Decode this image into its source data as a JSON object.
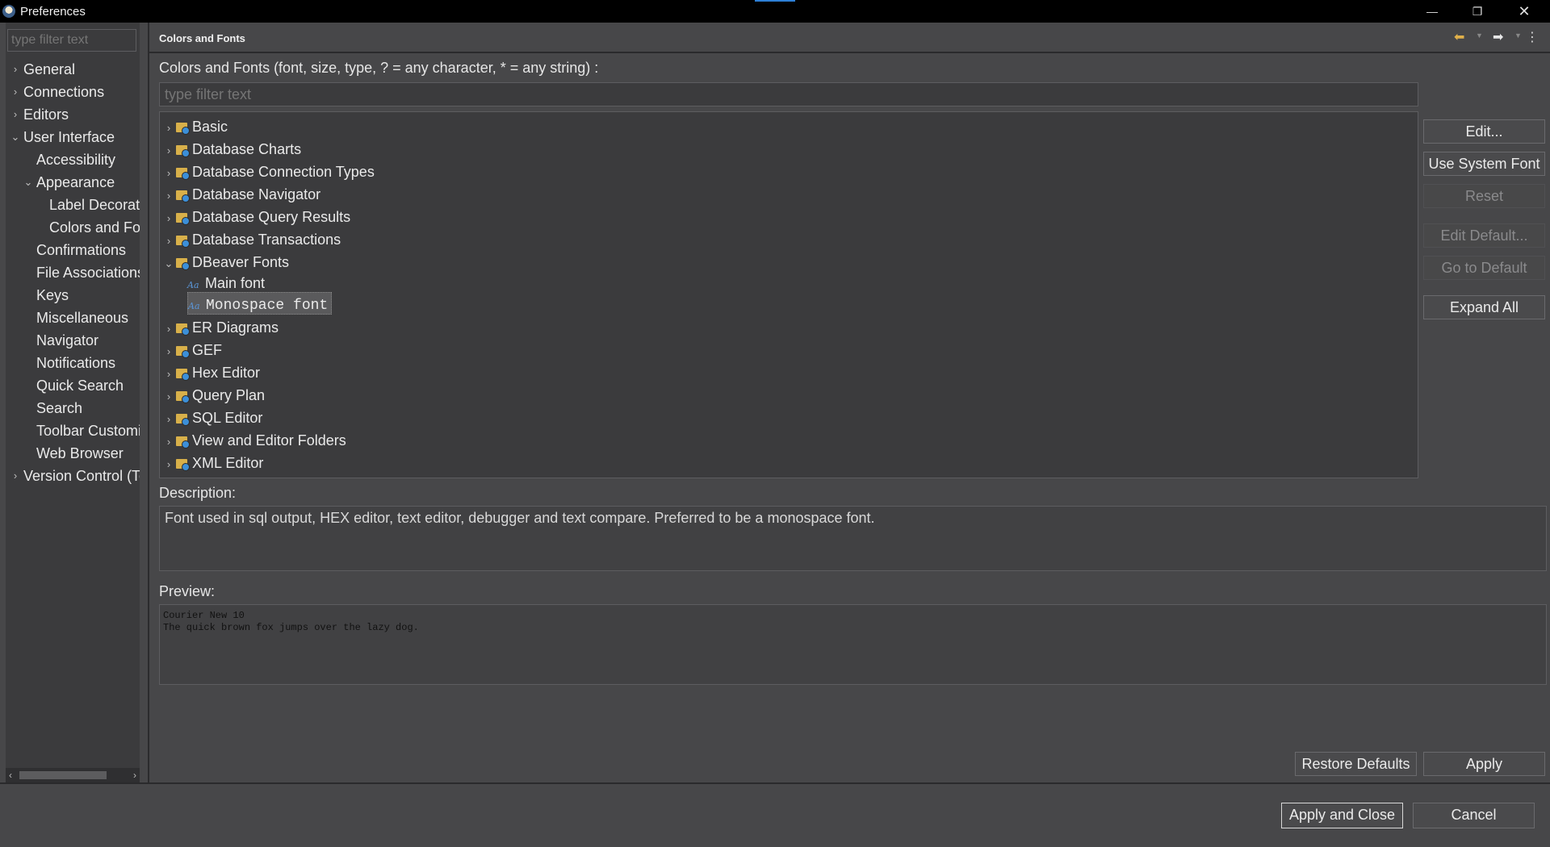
{
  "window": {
    "title": "Preferences"
  },
  "left": {
    "filter_placeholder": "type filter text",
    "items": [
      {
        "label": "General",
        "level": 0,
        "chevron": "›"
      },
      {
        "label": "Connections",
        "level": 0,
        "chevron": "›"
      },
      {
        "label": "Editors",
        "level": 0,
        "chevron": "›"
      },
      {
        "label": "User Interface",
        "level": 0,
        "chevron": "⌄"
      },
      {
        "label": "Accessibility",
        "level": 1,
        "chevron": ""
      },
      {
        "label": "Appearance",
        "level": 1,
        "chevron": "⌄"
      },
      {
        "label": "Label Decorati",
        "level": 2,
        "chevron": ""
      },
      {
        "label": "Colors and Fo",
        "level": 2,
        "chevron": ""
      },
      {
        "label": "Confirmations",
        "level": 1,
        "chevron": ""
      },
      {
        "label": "File Associations",
        "level": 1,
        "chevron": ""
      },
      {
        "label": "Keys",
        "level": 1,
        "chevron": ""
      },
      {
        "label": "Miscellaneous",
        "level": 1,
        "chevron": ""
      },
      {
        "label": "Navigator",
        "level": 1,
        "chevron": ""
      },
      {
        "label": "Notifications",
        "level": 1,
        "chevron": ""
      },
      {
        "label": "Quick Search",
        "level": 1,
        "chevron": ""
      },
      {
        "label": "Search",
        "level": 1,
        "chevron": ""
      },
      {
        "label": "Toolbar Customi",
        "level": 1,
        "chevron": ""
      },
      {
        "label": "Web Browser",
        "level": 1,
        "chevron": ""
      },
      {
        "label": "Version Control (Te",
        "level": 0,
        "chevron": "›"
      }
    ]
  },
  "header": {
    "title": "Colors and Fonts"
  },
  "main": {
    "filter_label": "Colors and Fonts (font, size, type, ? = any character, * = any string) :",
    "filter_placeholder": "type filter text",
    "tree": [
      {
        "label": "Basic",
        "type": "folder",
        "chevron": "›"
      },
      {
        "label": "Database Charts",
        "type": "folder",
        "chevron": "›"
      },
      {
        "label": "Database Connection Types",
        "type": "folder",
        "chevron": "›"
      },
      {
        "label": "Database Navigator",
        "type": "folder",
        "chevron": "›"
      },
      {
        "label": "Database Query Results",
        "type": "folder",
        "chevron": "›"
      },
      {
        "label": "Database Transactions",
        "type": "folder",
        "chevron": "›"
      },
      {
        "label": "DBeaver Fonts",
        "type": "folder",
        "chevron": "⌄"
      },
      {
        "label": "Main font",
        "type": "font",
        "chevron": ""
      },
      {
        "label": "Monospace font",
        "type": "font",
        "chevron": ""
      },
      {
        "label": "ER Diagrams",
        "type": "folder",
        "chevron": "›"
      },
      {
        "label": "GEF",
        "type": "folder",
        "chevron": "›"
      },
      {
        "label": "Hex Editor",
        "type": "folder",
        "chevron": "›"
      },
      {
        "label": "Query Plan",
        "type": "folder",
        "chevron": "›"
      },
      {
        "label": "SQL Editor",
        "type": "folder",
        "chevron": "›"
      },
      {
        "label": "View and Editor Folders",
        "type": "folder",
        "chevron": "›"
      },
      {
        "label": "XML Editor",
        "type": "folder",
        "chevron": "›"
      }
    ],
    "buttons": {
      "edit": "Edit...",
      "use_system_font": "Use System Font",
      "reset": "Reset",
      "edit_default": "Edit Default...",
      "go_to_default": "Go to Default",
      "expand_all": "Expand All"
    },
    "description_label": "Description:",
    "description": "Font used in sql output, HEX editor, text editor, debugger and text compare. Preferred to be a monospace font.",
    "preview_label": "Preview:",
    "preview_line1": "Courier New 10",
    "preview_line2": "The quick brown fox jumps over the lazy dog.",
    "restore_defaults": "Restore Defaults",
    "apply": "Apply"
  },
  "footer": {
    "apply_and_close": "Apply and Close",
    "cancel": "Cancel"
  }
}
